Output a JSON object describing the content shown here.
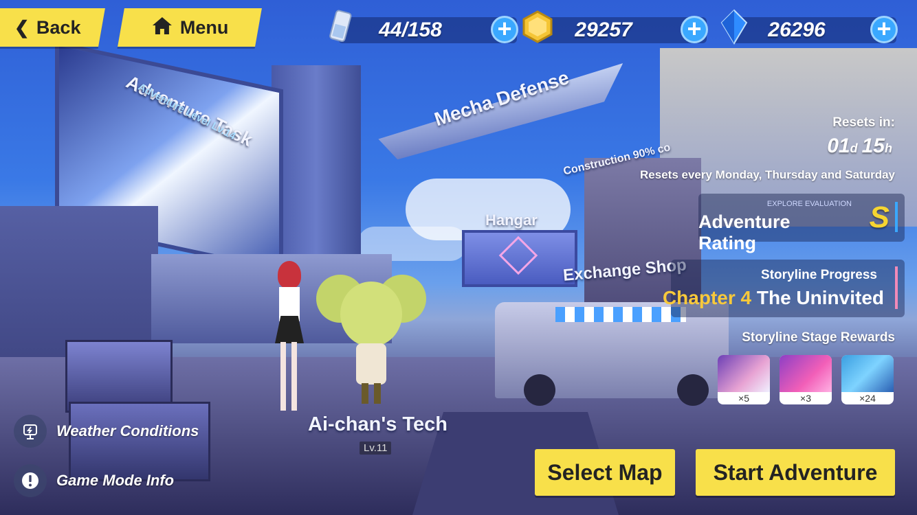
{
  "header": {
    "back_label": "Back",
    "menu_label": "Menu",
    "stamina": "44/158",
    "coins": "29257",
    "crystals": "26296"
  },
  "map_labels": {
    "adventure_task": "Adventure Task",
    "adventure_level": "Adventure Level Lv.14",
    "mecha_defense": "Mecha Defense",
    "construction": "Construction 90% co",
    "hangar": "Hangar",
    "exchange_shop": "Exchange Shop"
  },
  "character": {
    "name": "Ai-chan's Tech",
    "level": "Lv.11"
  },
  "reset": {
    "title": "Resets in:",
    "days": "01",
    "days_unit": "d",
    "hours": "15",
    "hours_unit": "h",
    "schedule": "Resets every Monday, Thursday and Saturday"
  },
  "evaluation": {
    "caption": "EXPLORE EVALUATION",
    "label": "Adventure Rating",
    "grade": "S"
  },
  "storyline": {
    "title": "Storyline Progress",
    "chapter": "Chapter 4",
    "name": "The Uninvited",
    "rewards_title": "Storyline Stage Rewards",
    "rewards": [
      {
        "icon": "character-card-icon",
        "count": "×5"
      },
      {
        "icon": "weapon-parts-icon",
        "count": "×3"
      },
      {
        "icon": "supply-box-icon",
        "count": "×24"
      }
    ]
  },
  "side": {
    "weather": "Weather Conditions",
    "mode_info": "Game Mode Info"
  },
  "actions": {
    "select_map": "Select Map",
    "start_adventure": "Start Adventure"
  },
  "colors": {
    "button_yellow": "#f8e04a",
    "chapter_gold": "#f8c93a",
    "grade_gold": "#f6d531",
    "plus_blue": "#3aa8ff"
  }
}
